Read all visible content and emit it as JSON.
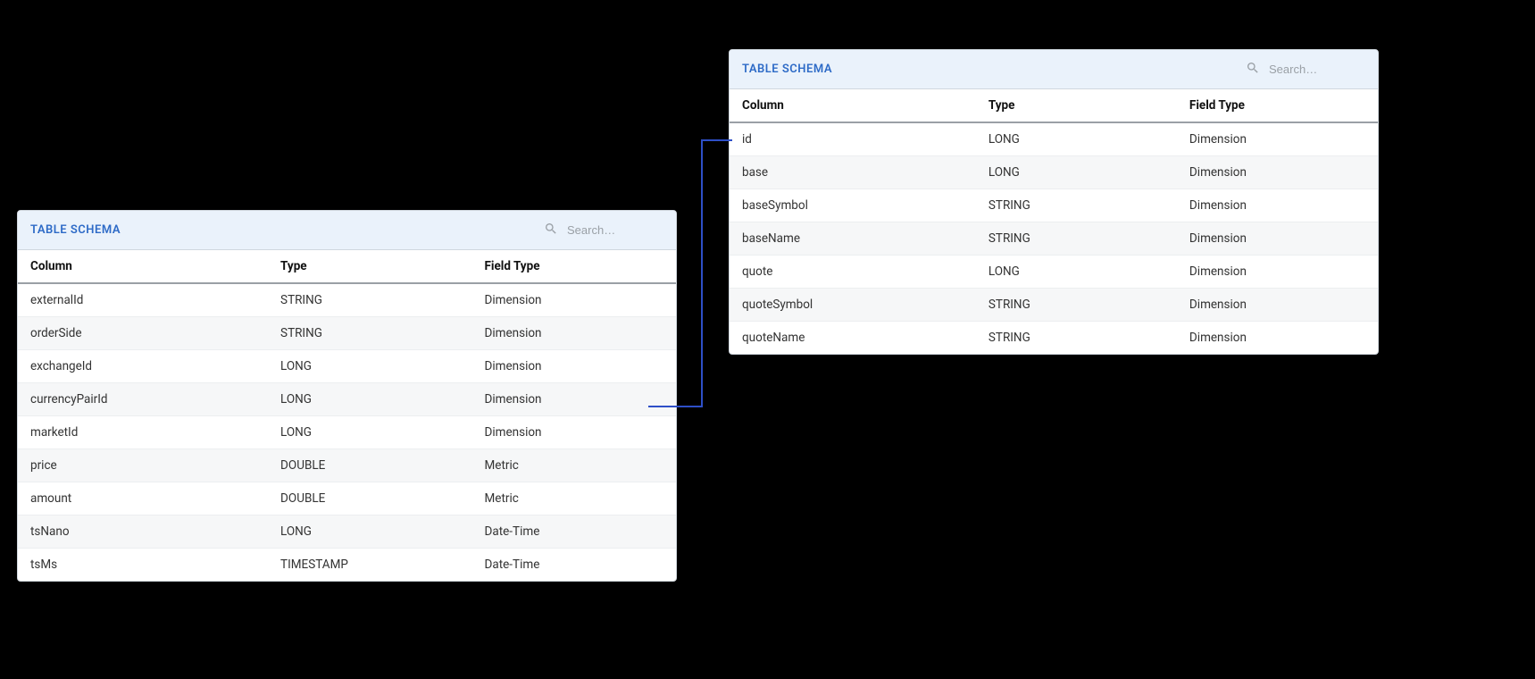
{
  "left": {
    "title": "TABLE SCHEMA",
    "search_placeholder": "Search…",
    "headers": {
      "col": "Column",
      "type": "Type",
      "fieldType": "Field Type"
    },
    "rows": [
      {
        "col": "externalId",
        "type": "STRING",
        "fieldType": "Dimension"
      },
      {
        "col": "orderSide",
        "type": "STRING",
        "fieldType": "Dimension"
      },
      {
        "col": "exchangeId",
        "type": "LONG",
        "fieldType": "Dimension"
      },
      {
        "col": "currencyPairId",
        "type": "LONG",
        "fieldType": "Dimension"
      },
      {
        "col": "marketId",
        "type": "LONG",
        "fieldType": "Dimension"
      },
      {
        "col": "price",
        "type": "DOUBLE",
        "fieldType": "Metric"
      },
      {
        "col": "amount",
        "type": "DOUBLE",
        "fieldType": "Metric"
      },
      {
        "col": "tsNano",
        "type": "LONG",
        "fieldType": "Date-Time"
      },
      {
        "col": "tsMs",
        "type": "TIMESTAMP",
        "fieldType": "Date-Time"
      }
    ]
  },
  "right": {
    "title": "TABLE SCHEMA",
    "search_placeholder": "Search…",
    "headers": {
      "col": "Column",
      "type": "Type",
      "fieldType": "Field Type"
    },
    "rows": [
      {
        "col": "id",
        "type": "LONG",
        "fieldType": "Dimension"
      },
      {
        "col": "base",
        "type": "LONG",
        "fieldType": "Dimension"
      },
      {
        "col": "baseSymbol",
        "type": "STRING",
        "fieldType": "Dimension"
      },
      {
        "col": "baseName",
        "type": "STRING",
        "fieldType": "Dimension"
      },
      {
        "col": "quote",
        "type": "LONG",
        "fieldType": "Dimension"
      },
      {
        "col": "quoteSymbol",
        "type": "STRING",
        "fieldType": "Dimension"
      },
      {
        "col": "quoteName",
        "type": "STRING",
        "fieldType": "Dimension"
      }
    ]
  }
}
